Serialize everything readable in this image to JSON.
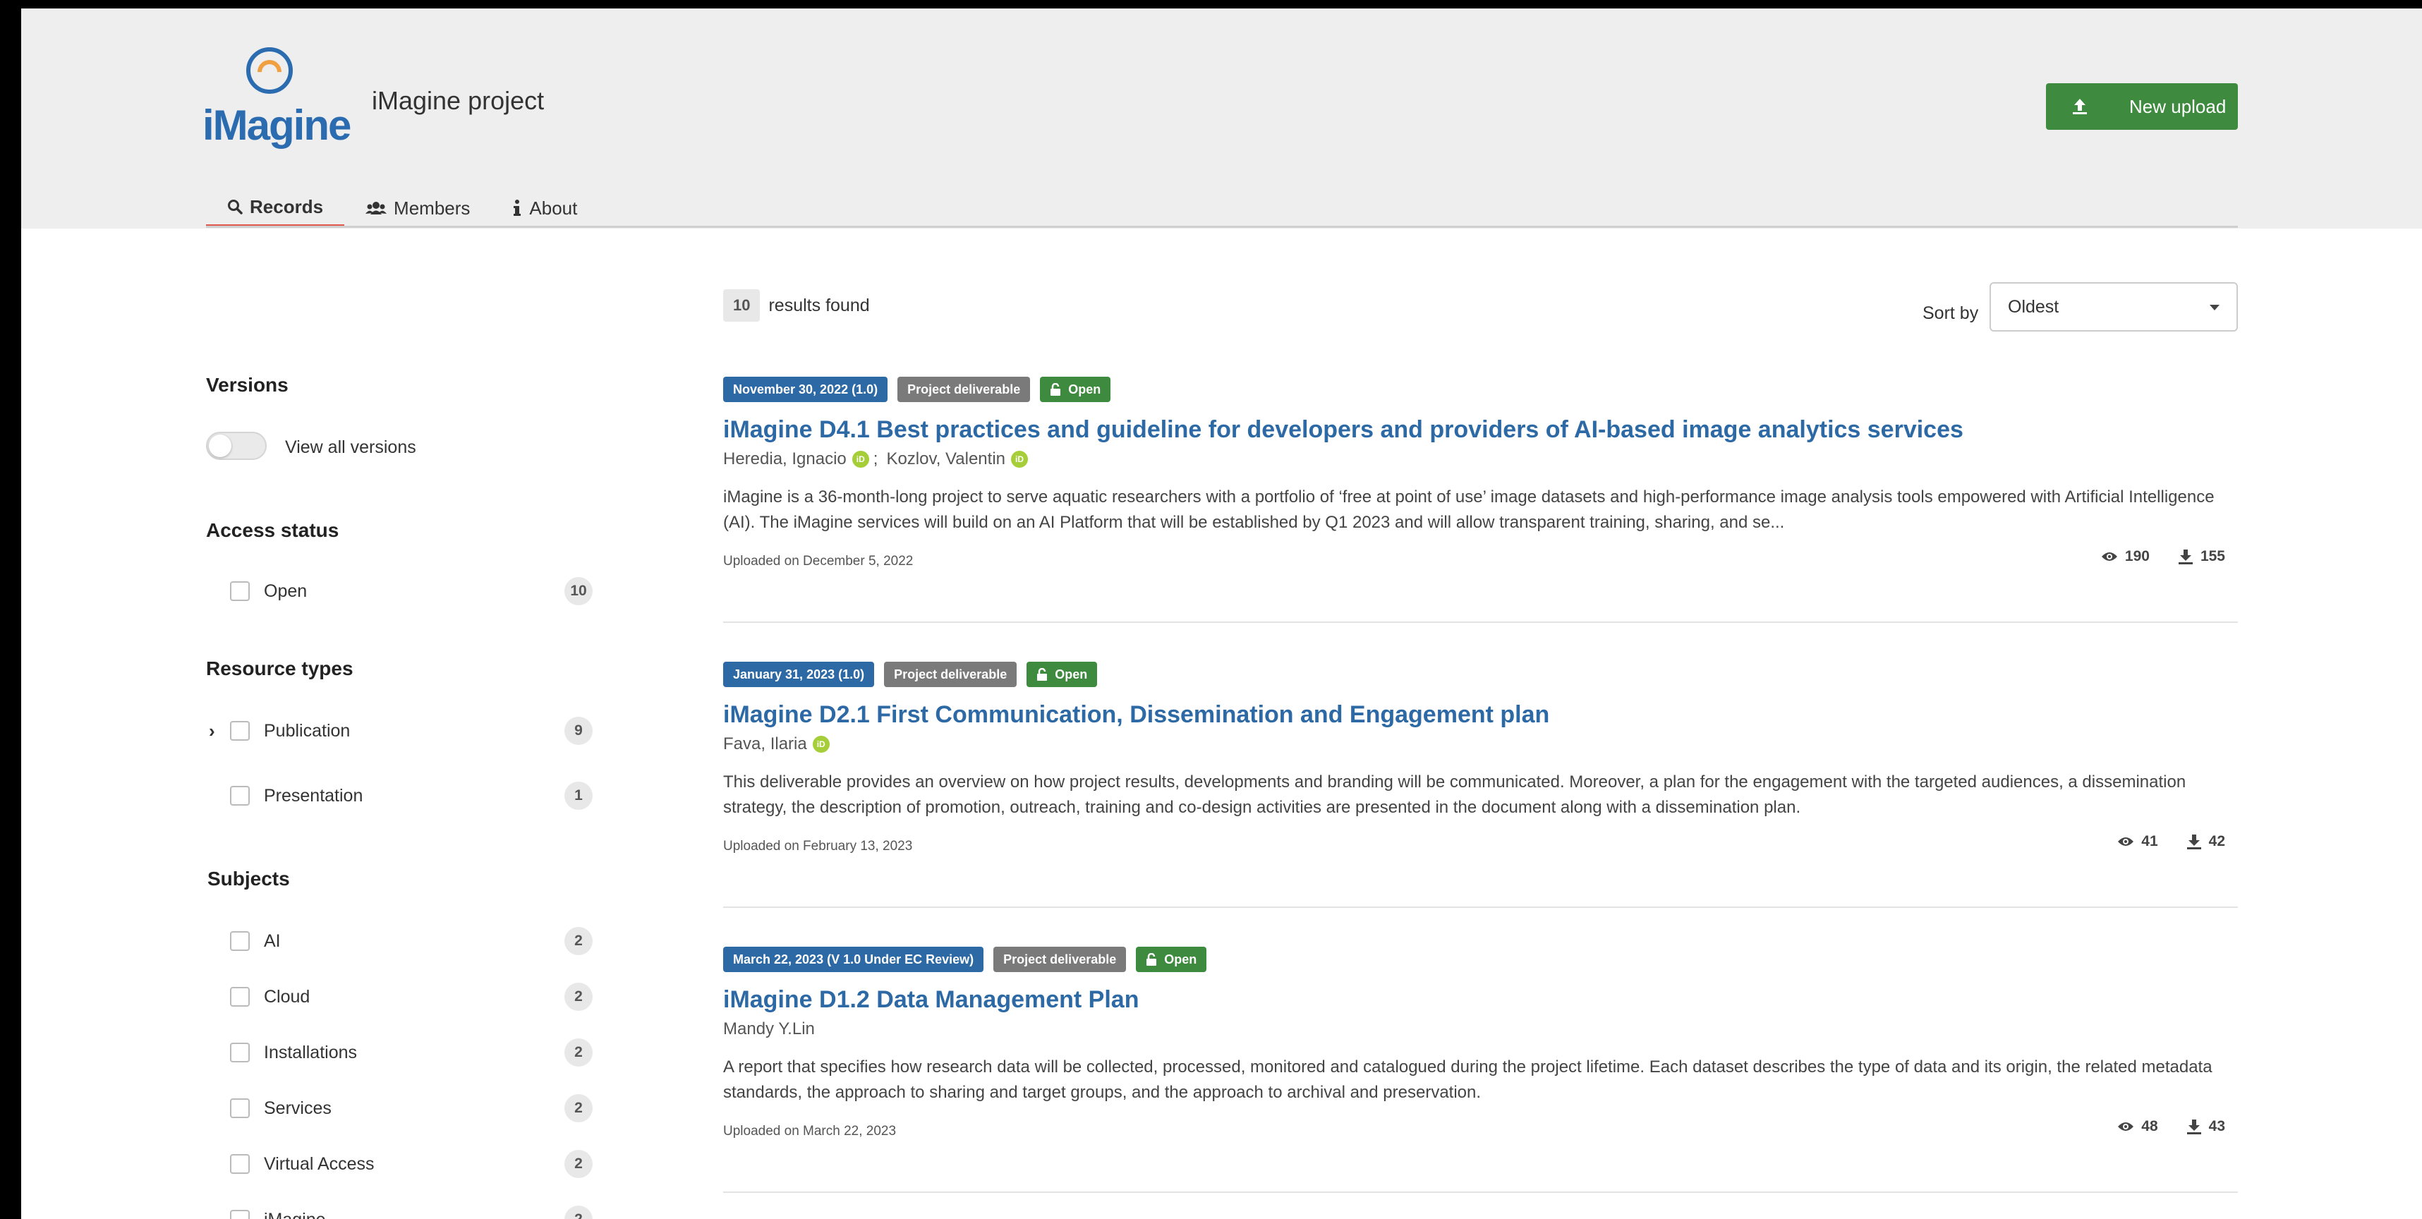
{
  "header": {
    "logo_text": "iMagine",
    "community_name": "iMagine project",
    "upload_button": "New upload",
    "tabs": [
      {
        "label": "Records",
        "icon": "search-icon"
      },
      {
        "label": "Members",
        "icon": "users-icon"
      },
      {
        "label": "About",
        "icon": "info-icon"
      }
    ]
  },
  "results": {
    "count": "10",
    "text": "results found",
    "sort_label": "Sort by",
    "sort_value": "Oldest"
  },
  "facets": {
    "versions": {
      "title": "Versions",
      "toggle_label": "View all versions"
    },
    "access": {
      "title": "Access status",
      "items": [
        {
          "label": "Open",
          "count": "10"
        }
      ]
    },
    "resource_types": {
      "title": "Resource types",
      "items": [
        {
          "label": "Publication",
          "count": "9"
        },
        {
          "label": "Presentation",
          "count": "1"
        }
      ]
    },
    "subjects": {
      "title": "Subjects",
      "items": [
        {
          "label": "AI",
          "count": "2"
        },
        {
          "label": "Cloud",
          "count": "2"
        },
        {
          "label": "Installations",
          "count": "2"
        },
        {
          "label": "Services",
          "count": "2"
        },
        {
          "label": "Virtual Access",
          "count": "2"
        },
        {
          "label": "iMagine",
          "count": "2"
        }
      ]
    }
  },
  "records": [
    {
      "date_label": "November 30, 2022 (1.0)",
      "type_label": "Project deliverable",
      "access_label": "Open",
      "title": "iMagine D4.1 Best practices and guideline for developers and providers of AI-based image analytics services",
      "authors": [
        "Heredia, Ignacio",
        "Kozlov, Valentin"
      ],
      "description": "iMagine is a 36-month-long project to serve aquatic researchers with a portfolio of ‘free at point of use’ image datasets and high-performance image analysis tools empowered with Artificial Intelligence (AI). The iMagine services will build on an AI Platform that will be established by Q1 2023 and will allow transparent training, sharing, and se...",
      "uploaded": "Uploaded on December 5, 2022",
      "views": "190",
      "downloads": "155"
    },
    {
      "date_label": "January 31, 2023 (1.0)",
      "type_label": "Project deliverable",
      "access_label": "Open",
      "title": "iMagine D2.1 First Communication, Dissemination and Engagement plan",
      "authors": [
        "Fava, Ilaria"
      ],
      "description": "This deliverable provides an overview on how project results, developments and branding will be communicated. Moreover, a plan for the engagement with the targeted audiences, a dissemination strategy, the description of promotion, outreach, training and co-design activities are presented in the document along with a dissemination plan.",
      "uploaded": "Uploaded on February 13, 2023",
      "views": "41",
      "downloads": "42"
    },
    {
      "date_label": "March 22, 2023 (V 1.0 Under EC Review)",
      "type_label": "Project deliverable",
      "access_label": "Open",
      "title": "iMagine D1.2 Data Management Plan",
      "authors": [
        "Mandy Y.Lin"
      ],
      "description": "A report that specifies how research data will be collected, processed, monitored and catalogued during the project lifetime. Each dataset describes the type of data and its origin, the related metadata standards, the approach to sharing and target groups, and the approach to archival and preservation.",
      "uploaded": "Uploaded on March 22, 2023",
      "views": "48",
      "downloads": "43"
    }
  ]
}
